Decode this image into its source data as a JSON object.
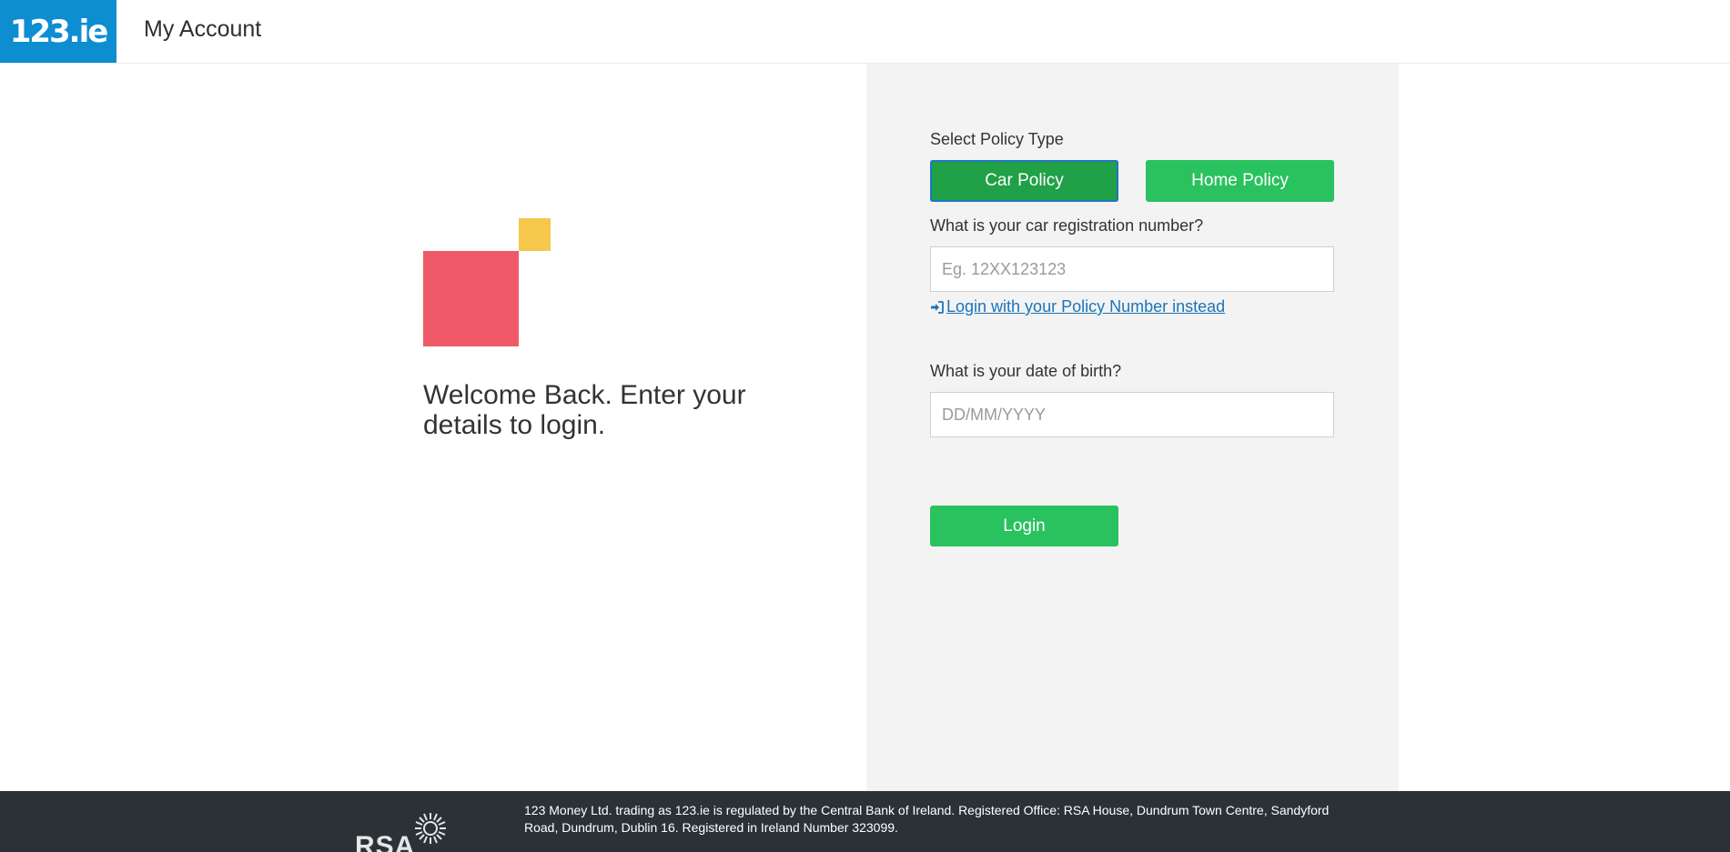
{
  "header": {
    "logo_text": "123.ie",
    "title": "My Account"
  },
  "hero": {
    "welcome": "Welcome Back. Enter your details to login."
  },
  "form": {
    "policy_type_label": "Select Policy Type",
    "car_policy": "Car Policy",
    "home_policy": "Home Policy",
    "selected_policy": "Car Policy",
    "registration_label": "What is your car registration number?",
    "registration_placeholder": "Eg. 12XX123123",
    "policy_number_link": "Login with your Policy Number instead",
    "dob_label": "What is your date of birth?",
    "dob_placeholder": "DD/MM/YYYY",
    "login_button": "Login"
  },
  "footer": {
    "rsa_logo_text": "RSA",
    "legal_text": "123 Money Ltd. trading as 123.ie is regulated by the Central Bank of Ireland. Registered Office: RSA House, Dundrum Town Centre, Sandyford Road, Dundrum, Dublin 16. Registered in Ireland Number 323099."
  },
  "colors": {
    "brand_blue": "#0c8ed0",
    "green": "#29c25e",
    "green_selected": "#20a047",
    "link": "#1b75bb",
    "mark_red": "#f05a68",
    "mark_yellow": "#f5c84b",
    "footer_bg": "#2b3237"
  },
  "icons": {
    "policy_link_icon": "sign-in-icon",
    "rsa_logo_icon": "sunburst-icon"
  }
}
